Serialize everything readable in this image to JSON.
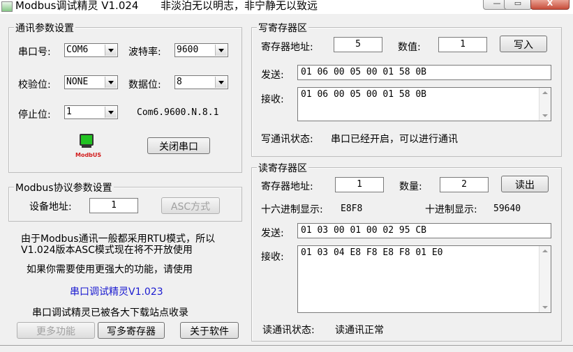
{
  "window": {
    "title": "Modbus调试精灵 V1.024",
    "motto": "非淡泊无以明志，非宁静无以致远",
    "btn_min": "—",
    "btn_max": "▭",
    "btn_close": "X"
  },
  "comm": {
    "group_label": "通讯参数设置",
    "port_label": "串口号:",
    "port_value": "COM6",
    "baud_label": "波特率:",
    "baud_value": "9600",
    "parity_label": "校验位:",
    "parity_value": "NONE",
    "databits_label": "数据位:",
    "databits_value": "8",
    "stopbits_label": "停止位:",
    "stopbits_value": "1",
    "status_text": "Com6.9600.N.8.1",
    "close_port_button": "关闭串口",
    "logo_text": "ModbUS"
  },
  "protocol": {
    "group_label": "Modbus协议参数设置",
    "device_address_label": "设备地址:",
    "device_address_value": "1",
    "asc_button": "ASC方式"
  },
  "info": {
    "line1": "由于Modbus通讯一般都采用RTU模式，所以",
    "line2": "V1.024版本ASC模式现在将不开放使用",
    "line3": "如果你需要使用更强大的功能，请使用",
    "link": "串口调试精灵V1.023",
    "line4": "串口调试精灵已被各大下载站点收录",
    "link_color": "#1a1ad0"
  },
  "bottom_buttons": {
    "more": "更多功能",
    "write_multi": "写多寄存器",
    "about": "关于软件"
  },
  "write": {
    "group_label": "写寄存器区",
    "addr_label": "寄存器地址:",
    "addr_value": "5",
    "value_label": "数值:",
    "value_value": "1",
    "write_button": "写入",
    "send_label": "发送:",
    "send_value": "01 06 00 05 00 01 58 0B",
    "recv_label": "接收:",
    "recv_value": "01 06 00 05 00 01 58 0B",
    "status_label": "写通讯状态:",
    "status_value": "串口已经开启，可以进行通讯"
  },
  "read": {
    "group_label": "读寄存器区",
    "addr_label": "寄存器地址:",
    "addr_value": "1",
    "count_label": "数量:",
    "count_value": "2",
    "read_button": "读出",
    "hex_label": "十六进制显示:",
    "hex_value": "E8F8",
    "dec_label": "十进制显示:",
    "dec_value": "59640",
    "send_label": "发送:",
    "send_value": "01 03 00 01 00 02 95 CB",
    "recv_label": "接收:",
    "recv_value": "01 03 04 E8 F8 E8 F8 01 E0",
    "status_label": "读通讯状态:",
    "status_value": "读通讯正常"
  }
}
